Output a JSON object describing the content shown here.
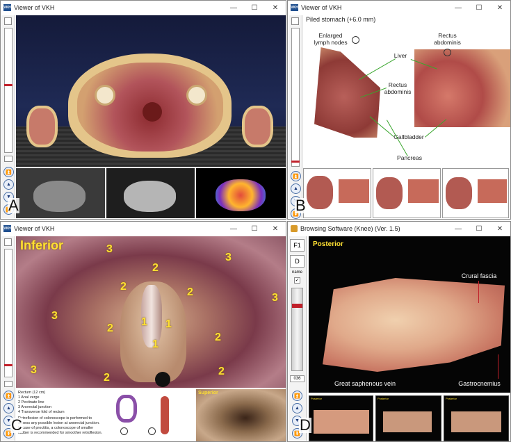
{
  "panels": {
    "a": {
      "title": "Viewer of VKH",
      "caption": "A"
    },
    "b": {
      "title": "Viewer of VKH",
      "caption": "B",
      "section_label": "Piled stomach (+6.0 mm)",
      "labels": {
        "enlarged_lymph": "Enlarged lymph nodes",
        "rectus_top": "Rectus abdominis",
        "liver": "Liver",
        "rectus_mid": "Rectus abdominis",
        "gallbladder": "Gallbladder",
        "pancreas": "Pancreas"
      }
    },
    "c": {
      "title": "Viewer of VKH",
      "caption": "C",
      "view_label": "Inferior",
      "numbers": [
        "3",
        "3",
        "3",
        "3",
        "3",
        "2",
        "2",
        "2",
        "2",
        "2",
        "2",
        "2",
        "1",
        "1",
        "1"
      ],
      "info_title": "Rectum (12 cm)",
      "info_items": [
        "1 Anal verge",
        "2 Pectinate line",
        "3 Anorectal junction",
        "4 Transverse fold of rectum"
      ],
      "info_note": "Retroflexion of colonoscope is performed to assess any possible lesion at anorectal junction. In case of proctitis, a colonoscope of smaller caliber is recommended for smoother retroflexion.",
      "thumb_label": "Superior"
    },
    "d": {
      "title": "Browsing Software (Knee)  (Ver. 1.5)",
      "caption": "D",
      "btn_f1": "F1",
      "btn_d": "D",
      "name_label": "name",
      "slice_number": "036",
      "view_label": "Posterior",
      "labels": {
        "crural_fascia": "Crural fascia",
        "great_saphenous": "Great saphenous vein",
        "gastrocnemius": "Gastrocnemius"
      },
      "thumb_labels": [
        "Posterior",
        "Posterior",
        "Posterior"
      ]
    }
  },
  "controls": {
    "minimize": "—",
    "maximize": "☐",
    "close": "✕",
    "nav_up_fast": "⏫",
    "nav_up": "▲",
    "nav_down": "▼",
    "nav_down_fast": "⏬"
  },
  "colors": {
    "accent_yellow": "#ffe033",
    "guide_green": "#3aa62e",
    "slider_red": "#c0202a",
    "nav_blue": "#1b3a78"
  }
}
